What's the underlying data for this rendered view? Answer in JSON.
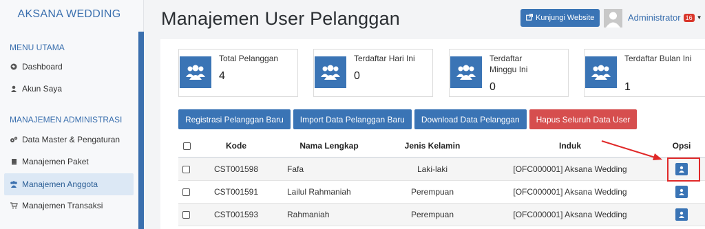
{
  "sidebar": {
    "brand": "AKSANA WEDDING",
    "section_main": "MENU UTAMA",
    "section_admin": "MANAJEMEN ADMINISTRASI",
    "items": [
      {
        "label": "Dashboard",
        "icon": "globe-icon"
      },
      {
        "label": "Akun Saya",
        "icon": "user-icon"
      },
      {
        "label": "Data Master & Pengaturan",
        "icon": "cogs-icon"
      },
      {
        "label": "Manajemen Paket",
        "icon": "book-icon"
      },
      {
        "label": "Manajemen Anggota",
        "icon": "users-icon",
        "active": true
      },
      {
        "label": "Manajemen Transaksi",
        "icon": "cart-icon"
      }
    ]
  },
  "header": {
    "title": "Manajemen User Pelanggan",
    "visit_label": "Kunjungi Website",
    "user_name": "Administrator",
    "notif_count": "16"
  },
  "stats": [
    {
      "label": "Total Pelanggan",
      "value": "4"
    },
    {
      "label": "Terdaftar Hari Ini",
      "value": "0"
    },
    {
      "label": "Terdaftar Minggu Ini",
      "value": "0"
    },
    {
      "label": "Terdaftar Bulan Ini",
      "value": "1"
    }
  ],
  "actions": {
    "register": "Registrasi Pelanggan Baru",
    "import": "Import Data Pelanggan Baru",
    "download": "Download Data Pelanggan",
    "delete_all": "Hapus Seluruh Data User"
  },
  "table": {
    "headers": [
      "Kode",
      "Nama Lengkap",
      "Jenis Kelamin",
      "Induk",
      "Opsi"
    ],
    "rows": [
      {
        "kode": "CST001598",
        "nama": "Fafa",
        "jk": "Laki-laki",
        "induk": "[OFC000001] Aksana Wedding"
      },
      {
        "kode": "CST001591",
        "nama": "Lailul Rahmaniah",
        "jk": "Perempuan",
        "induk": "[OFC000001] Aksana Wedding"
      },
      {
        "kode": "CST001593",
        "nama": "Rahmaniah",
        "jk": "Perempuan",
        "induk": "[OFC000001] Aksana Wedding"
      }
    ]
  },
  "colors": {
    "primary": "#3a74b5",
    "danger": "#d64e4e",
    "highlight": "#e02828"
  }
}
